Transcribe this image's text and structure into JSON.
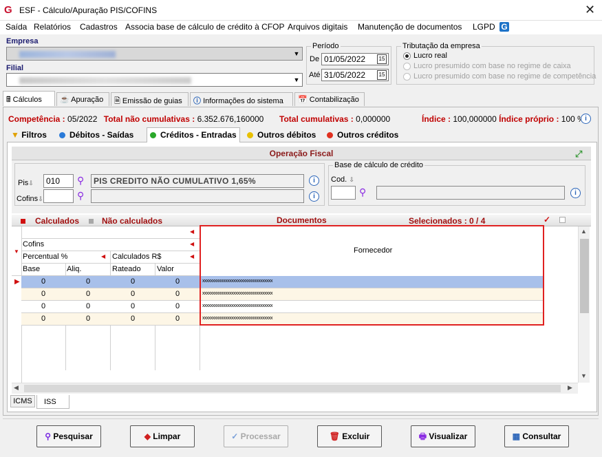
{
  "window": {
    "title": "ESF - Cálculo/Apuração PIS/COFINS",
    "close": "✕"
  },
  "menu": [
    "Saída",
    "Relatórios",
    "Cadastros",
    "Associa base de cálculo de crédito à CFOP",
    "Arquivos digitais",
    "Manutenção de documentos",
    "LGPD"
  ],
  "empresa": {
    "label": "Empresa"
  },
  "filial": {
    "label": "Filial"
  },
  "periodo": {
    "legend": "Período",
    "de_label": "De",
    "de_value": "01/05/2022",
    "ate_label": "Até",
    "ate_value": "31/05/2022"
  },
  "tributacao": {
    "legend": "Tributação da empresa",
    "options": [
      "Lucro real",
      "Lucro presumido com base no regime de caixa",
      "Lucro presumido com base no regime de competência"
    ],
    "selected": "Lucro real"
  },
  "main_tabs": [
    "Cálculos",
    "Apuração",
    "Emissão de guias",
    "Informações do sistema",
    "Contabilização"
  ],
  "summary": {
    "competencia_label": "Competência :",
    "competencia_value": "05/2022",
    "total_nao_cum_label": "Total não cumulativas :",
    "total_nao_cum_value": "6.352.676,160000",
    "total_cum_label": "Total cumulativas :",
    "total_cum_value": "0,000000",
    "indice_label": "Índice :",
    "indice_value": "100,000000",
    "indice_proprio_label": "Índice próprio :",
    "indice_proprio_value": "100 %"
  },
  "sub_tabs": [
    {
      "label": "Filtros",
      "color": "#e0a000"
    },
    {
      "label": "Débitos - Saídas",
      "color": "#2a7ad8"
    },
    {
      "label": "Créditos - Entradas",
      "color": "#2aa82a"
    },
    {
      "label": "Outros débitos",
      "color": "#e8c000"
    },
    {
      "label": "Outros créditos",
      "color": "#e03020"
    }
  ],
  "operacao": {
    "title": "Operação Fiscal",
    "pis_label": "Pis",
    "pis_code": "010",
    "pis_desc": "PIS CREDITO NÃO CUMULATIVO 1,65%",
    "cofins_label": "Cofins",
    "cofins_code": "",
    "cofins_desc": "",
    "base_legend": "Base de cálculo de crédito",
    "cod_label": "Cod."
  },
  "grid": {
    "calculados": "Calculados",
    "nao_calculados": "Não calculados",
    "documentos": "Documentos",
    "selecionados": "Selecionados : 0 / 4",
    "cofins": "Cofins",
    "percentual": "Percentual %",
    "calculados_rs": "Calculados R$",
    "cols": [
      "Base",
      "Aliq.",
      "Rateado",
      "Valor"
    ],
    "fornecedor": "Fornecedor",
    "rows": [
      {
        "base": "0",
        "aliq": "0",
        "rateado": "0",
        "valor": "0",
        "fornecedor": "xxxxxxxxxxxxxxxxxxxxxxxxxxxxxxxxxx"
      },
      {
        "base": "0",
        "aliq": "0",
        "rateado": "0",
        "valor": "0",
        "fornecedor": "xxxxxxxxxxxxxxxxxxxxxxxxxxxxxxxxxx"
      },
      {
        "base": "0",
        "aliq": "0",
        "rateado": "0",
        "valor": "0",
        "fornecedor": "xxxxxxxxxxxxxxxxxxxxxxxxxxxxxxxxxx"
      },
      {
        "base": "0",
        "aliq": "0",
        "rateado": "0",
        "valor": "0",
        "fornecedor": "xxxxxxxxxxxxxxxxxxxxxxxxxxxxxxxxxx"
      }
    ]
  },
  "bottom_tabs": [
    "ICMS",
    "ISS"
  ],
  "buttons": {
    "pesquisar": "Pesquisar",
    "limpar": "Limpar",
    "processar": "Processar",
    "excluir": "Excluir",
    "visualizar": "Visualizar",
    "consultar": "Consultar"
  }
}
